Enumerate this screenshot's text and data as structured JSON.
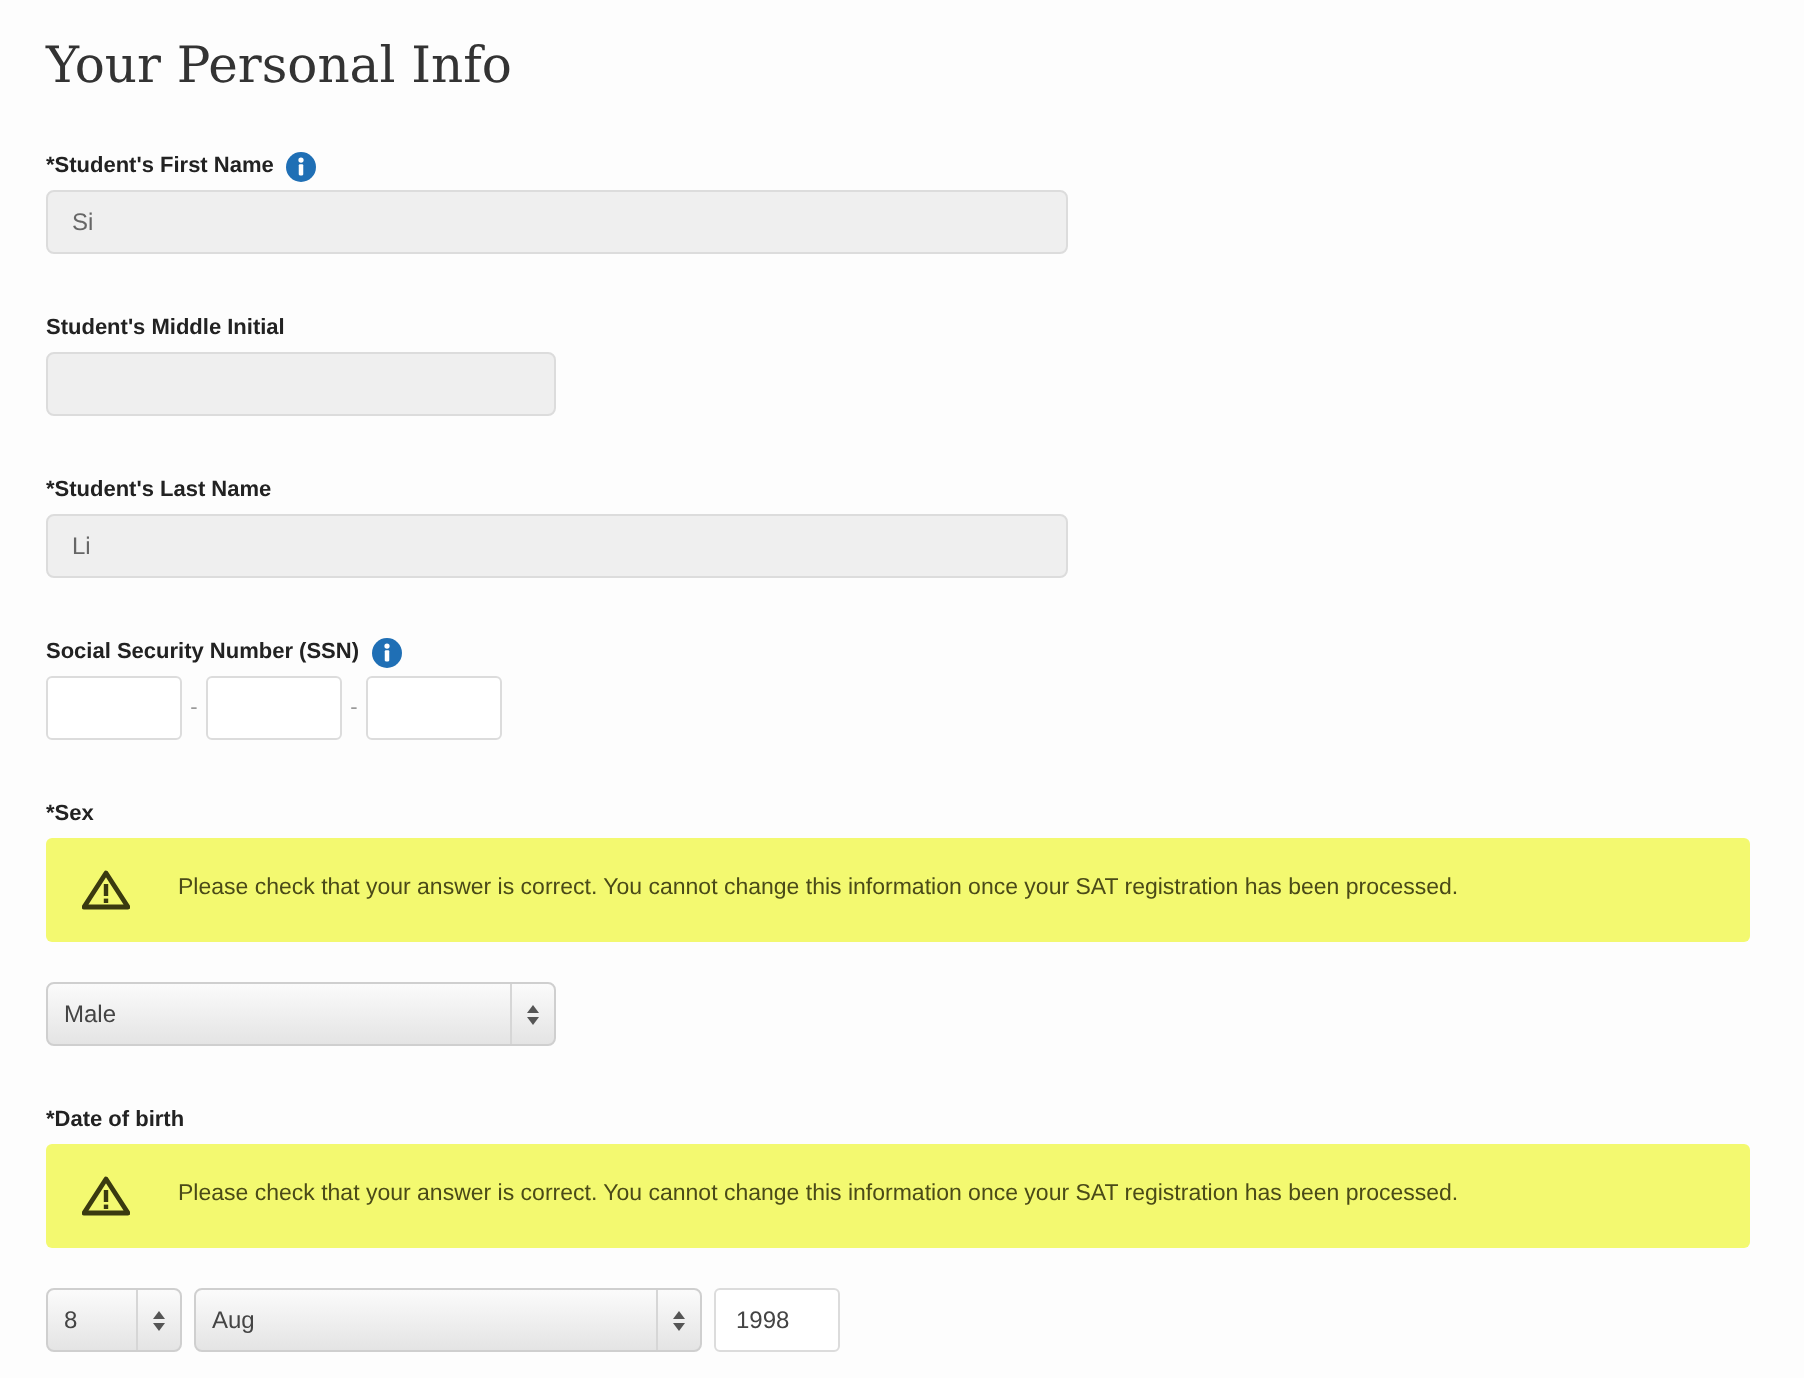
{
  "title": "Your Personal Info",
  "fields": [
    {
      "kind": "text",
      "label": "*Student's First Name",
      "info": true,
      "value": "Si"
    },
    {
      "kind": "initial",
      "label": "Student's Middle Initial",
      "info": false
    },
    {
      "kind": "text",
      "label": "*Student's Last Name",
      "info": false,
      "value": "Li"
    },
    {
      "kind": "ssn",
      "label": "Social Security Number (SSN)",
      "info": true,
      "separators": [
        "-",
        "-"
      ]
    },
    {
      "kind": "select",
      "label": "*Sex",
      "info": false,
      "warning": "Please check that your answer is correct. You cannot change this information once your SAT registration has been processed.",
      "value": "Male"
    },
    {
      "kind": "date",
      "label": "*Date of birth",
      "info": false,
      "warning": "Please check that your answer is correct. You cannot change this information once your SAT registration has been processed.",
      "day": "8",
      "month": "Aug",
      "year": "1998"
    }
  ]
}
